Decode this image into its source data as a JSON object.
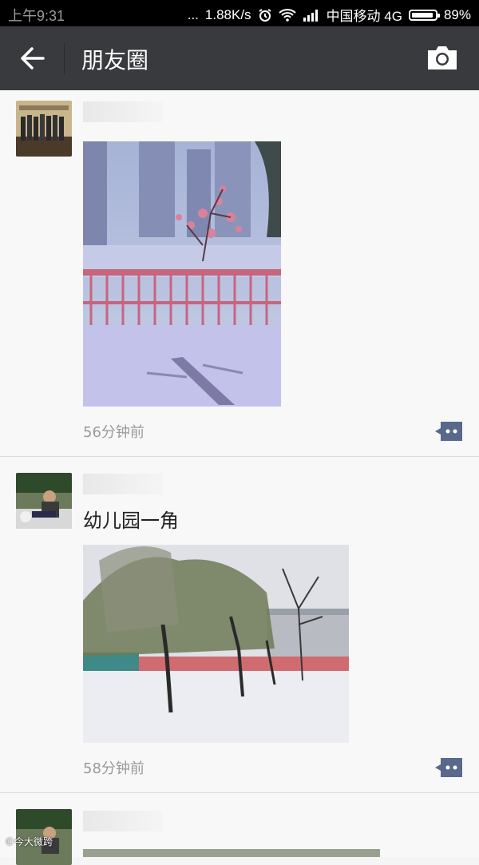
{
  "status_bar": {
    "time": "上午9:31",
    "dots": "...",
    "speed": "1.88K/s",
    "carrier": "中国移动 4G",
    "battery": "89%"
  },
  "app_bar": {
    "title": "朋友圈"
  },
  "posts": [
    {
      "caption": "",
      "time": "56分钟前"
    },
    {
      "caption": "幼儿园一角",
      "time": "58分钟前"
    }
  ],
  "watermark": "©今大微跨",
  "colors": {
    "appbar": "#393a3e",
    "comment": "#58698c"
  }
}
